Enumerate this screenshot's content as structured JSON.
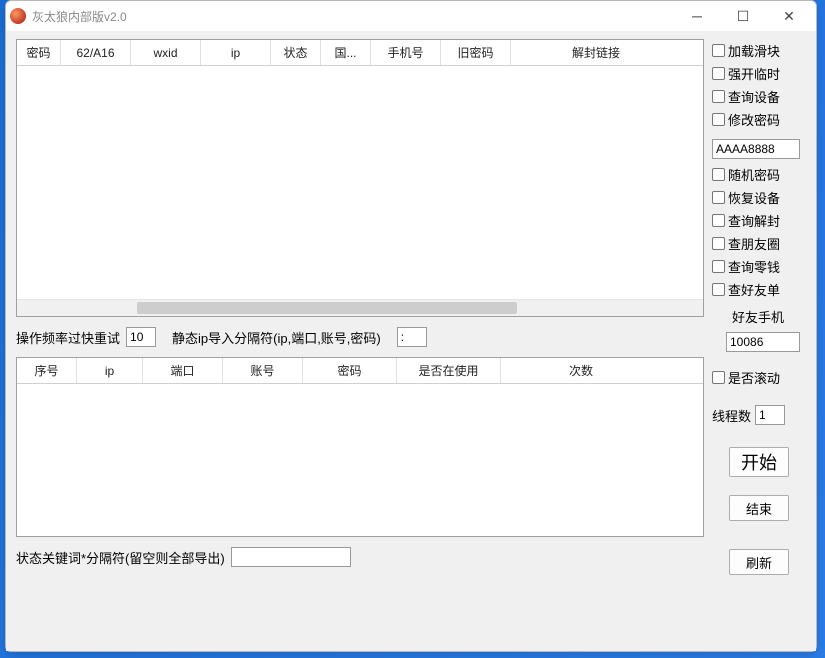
{
  "window": {
    "title": "灰太狼内部版v2.0"
  },
  "table1": {
    "columns": [
      "密码",
      "62/A16",
      "wxid",
      "ip",
      "状态",
      "国...",
      "手机号",
      "旧密码",
      "解封链接"
    ],
    "widths": [
      44,
      70,
      70,
      70,
      50,
      50,
      70,
      70,
      170
    ]
  },
  "midrow": {
    "retry_label": "操作频率过快重试",
    "retry_value": "10",
    "delim_label": "静态ip导入分隔符(ip,端口,账号,密码)",
    "delim_value": ":"
  },
  "table2": {
    "columns": [
      "序号",
      "ip",
      "端口",
      "账号",
      "密码",
      "是否在使用",
      "次数"
    ],
    "widths": [
      60,
      66,
      80,
      80,
      94,
      104,
      160
    ]
  },
  "bottom": {
    "keyword_label": "状态关键词*分隔符(留空则全部导出)",
    "keyword_value": ""
  },
  "side": {
    "checks_top": [
      "加载滑块",
      "强开临时",
      "查询设备",
      "修改密码"
    ],
    "pw_input": "AAAA8888",
    "checks_mid": [
      "随机密码",
      "恢复设备",
      "查询解封",
      "查朋友圈",
      "查询零钱",
      "查好友单"
    ],
    "phone_label": "好友手机",
    "phone_value": "10086",
    "scroll_check": "是否滚动",
    "thread_label": "线程数",
    "thread_value": "1",
    "btn_start": "开始",
    "btn_end": "结束",
    "btn_refresh": "刷新"
  }
}
